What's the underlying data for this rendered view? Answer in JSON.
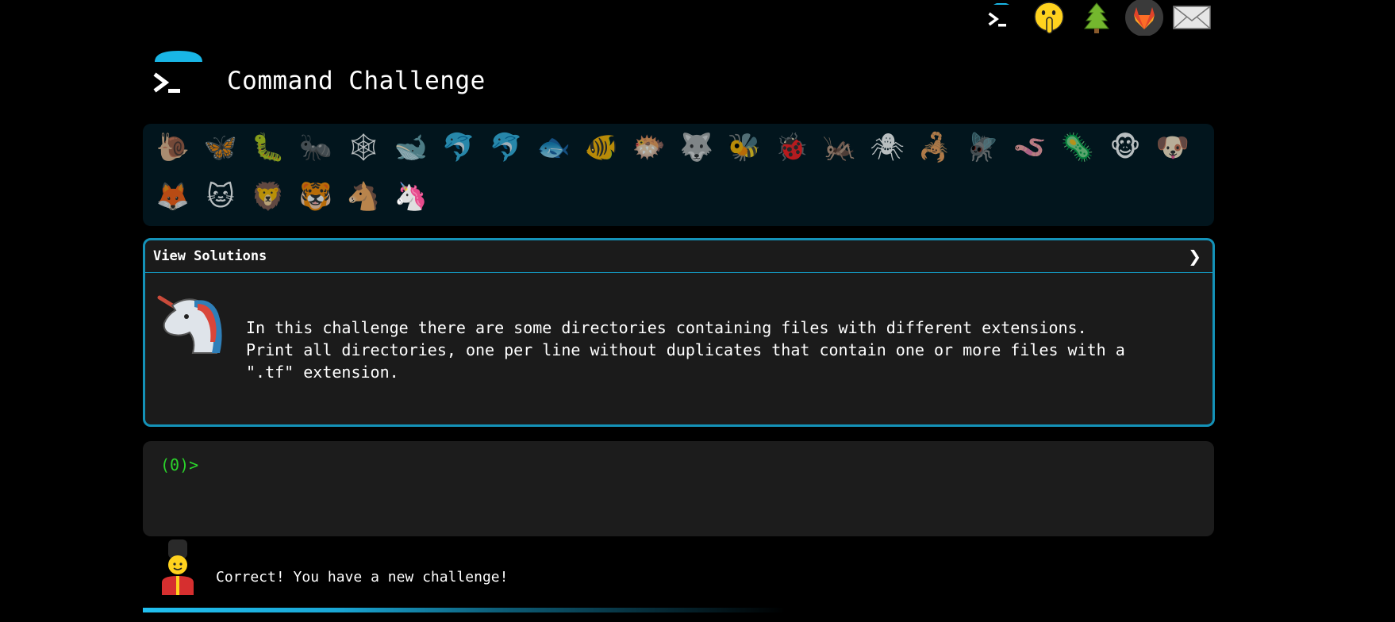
{
  "topbar": {
    "icons": [
      "terminal-icon",
      "shushing-face-icon",
      "tree-icon",
      "gitlab-icon",
      "mail-icon"
    ]
  },
  "header": {
    "title": "Command Challenge"
  },
  "animals": {
    "row1": [
      "🐌",
      "🦋",
      "🐛",
      "🐜",
      "🕸",
      "🐋",
      "🐬",
      "🐬",
      "🐟",
      "🐠",
      "🐡",
      "🐺",
      "🐝",
      "🐞",
      "🦗",
      "🕷",
      "🦂",
      "🪰",
      "🪱",
      "🦠",
      "🐵",
      "🐶"
    ],
    "row2": [
      "🦊",
      "🐱",
      "🦁",
      "🐯",
      "🐴",
      "🦄"
    ]
  },
  "challenge": {
    "solutions_label": "View Solutions",
    "chevron": "❯",
    "text": "In this challenge there are some directories containing files with different extensions.\nPrint all directories, one per line without duplicates that contain one or more files with a\n\".tf\" extension."
  },
  "terminal": {
    "prompt": "(0)>",
    "value": ""
  },
  "status": {
    "message": "Correct! You have a new challenge!"
  },
  "progress": {
    "fraction": 0.6
  },
  "colors": {
    "accent": "#1492b8",
    "prompt": "#2bd42b",
    "background": "#000000"
  }
}
